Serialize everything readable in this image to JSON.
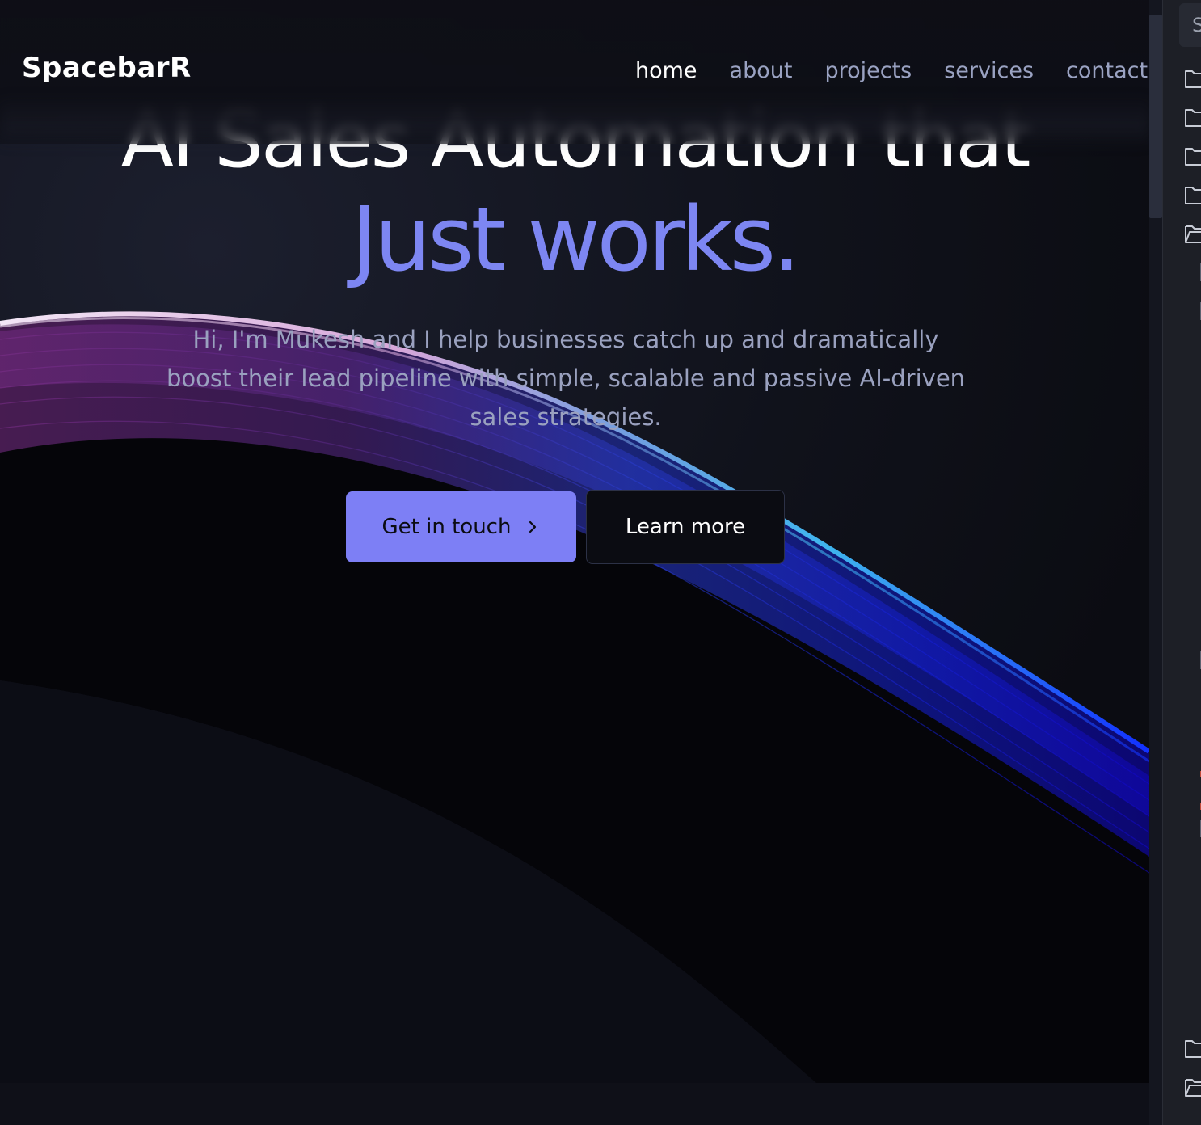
{
  "site": {
    "logo": "SpacebarR",
    "nav": [
      {
        "label": "home",
        "active": true
      },
      {
        "label": "about",
        "active": false
      },
      {
        "label": "projects",
        "active": false
      },
      {
        "label": "services",
        "active": false
      },
      {
        "label": "contact",
        "active": false
      }
    ]
  },
  "hero": {
    "line1": "AI Sales Automation that",
    "line2": "Just works.",
    "subtitle": "Hi, I'm Mukesh and I help businesses catch up and dramatically boost their lead pipeline with simple, scalable and passive AI-driven sales strategies.",
    "primary_button": "Get in touch",
    "secondary_button": "Learn more"
  },
  "side_panel": {
    "search_glyph": "S",
    "icons": [
      "folder-icon",
      "folder-icon",
      "folder-icon",
      "folder-icon",
      "folder-open-icon",
      "folder-icon",
      "folder-open-icon"
    ]
  },
  "colors": {
    "accent": "#7d7ff5",
    "headline_accent": "#7d86f2",
    "background": "#0b0c12"
  }
}
